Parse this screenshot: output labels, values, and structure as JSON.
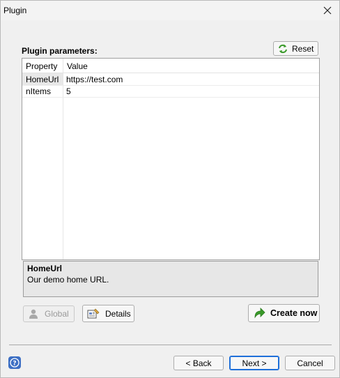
{
  "window": {
    "title": "Plugin"
  },
  "params": {
    "label": "Plugin parameters:",
    "reset_label": "Reset",
    "columns": [
      "Property",
      "Value"
    ],
    "rows": [
      {
        "property": "HomeUrl",
        "value": "https://test.com",
        "selected": true
      },
      {
        "property": "nItems",
        "value": "5",
        "selected": false
      }
    ]
  },
  "description": {
    "title": "HomeUrl",
    "text": "Our demo home URL."
  },
  "actions": {
    "global_label": "Global",
    "global_enabled": false,
    "details_label": "Details",
    "create_label": "Create now"
  },
  "footer": {
    "back_label": "< Back",
    "next_label": "Next >",
    "cancel_label": "Cancel"
  },
  "colors": {
    "accent": "#1e6fd9",
    "help_blue": "#3d6fc4",
    "create_green": "#3a9a2a"
  }
}
